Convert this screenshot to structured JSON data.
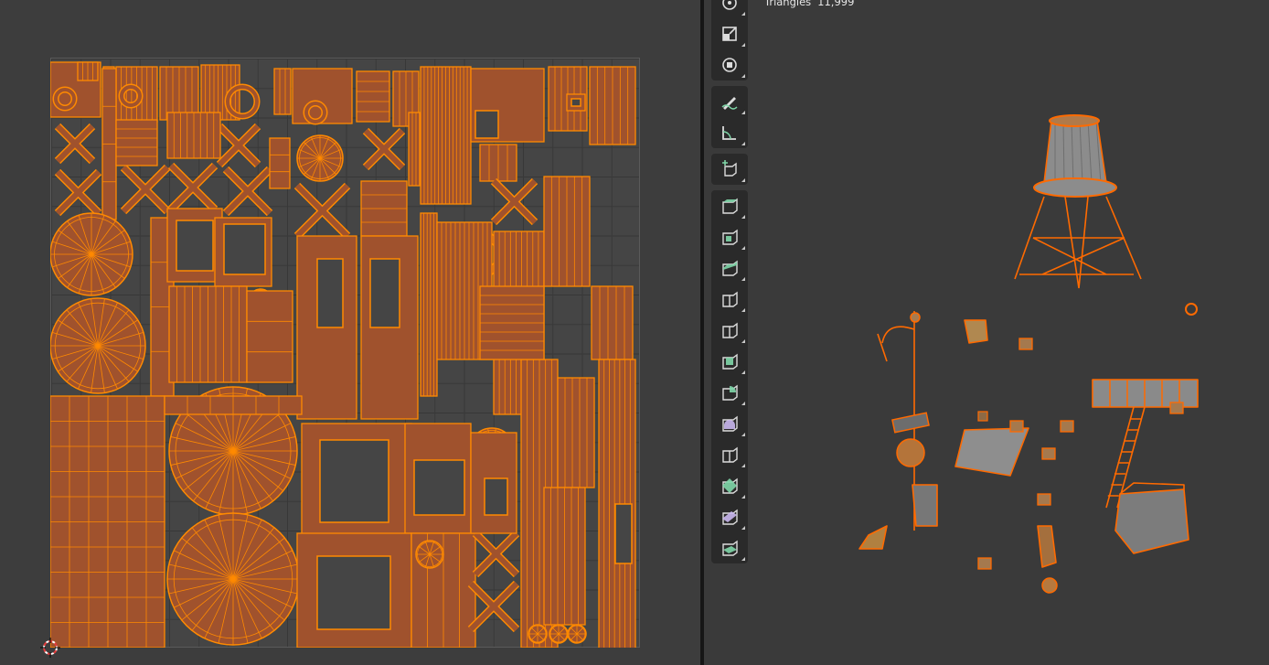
{
  "uv_editor": {
    "grid": "uv-grid",
    "cursor_icon": "3d-cursor-icon"
  },
  "viewport": {
    "stats": {
      "label": "Triangles",
      "value": "11,999"
    },
    "toolbar": {
      "groups": [
        [
          {
            "name": "rotate-icon"
          },
          {
            "name": "scale-icon"
          },
          {
            "name": "transform-icon"
          }
        ],
        [
          {
            "name": "annotate-icon"
          },
          {
            "name": "measure-icon"
          }
        ],
        [
          {
            "name": "add-cube-icon"
          }
        ],
        [
          {
            "name": "extrude-region-icon"
          },
          {
            "name": "inset-faces-icon"
          },
          {
            "name": "bevel-icon"
          },
          {
            "name": "loop-cut-icon"
          },
          {
            "name": "knife-icon"
          },
          {
            "name": "poly-build-icon"
          },
          {
            "name": "spin-icon"
          },
          {
            "name": "smooth-vertices-icon"
          },
          {
            "name": "edge-slide-icon"
          },
          {
            "name": "shrink-fatten-icon"
          },
          {
            "name": "shear-icon"
          },
          {
            "name": "rip-region-icon"
          }
        ]
      ]
    }
  },
  "colors": {
    "uv_fill": "#a0522d",
    "uv_stroke": "#ff8a00",
    "selected_outline": "#ff6a00",
    "editor_bg": "#3d3d3d",
    "toolbar_bg": "#2a2a2a",
    "active_icon": "#7fd6a8"
  }
}
